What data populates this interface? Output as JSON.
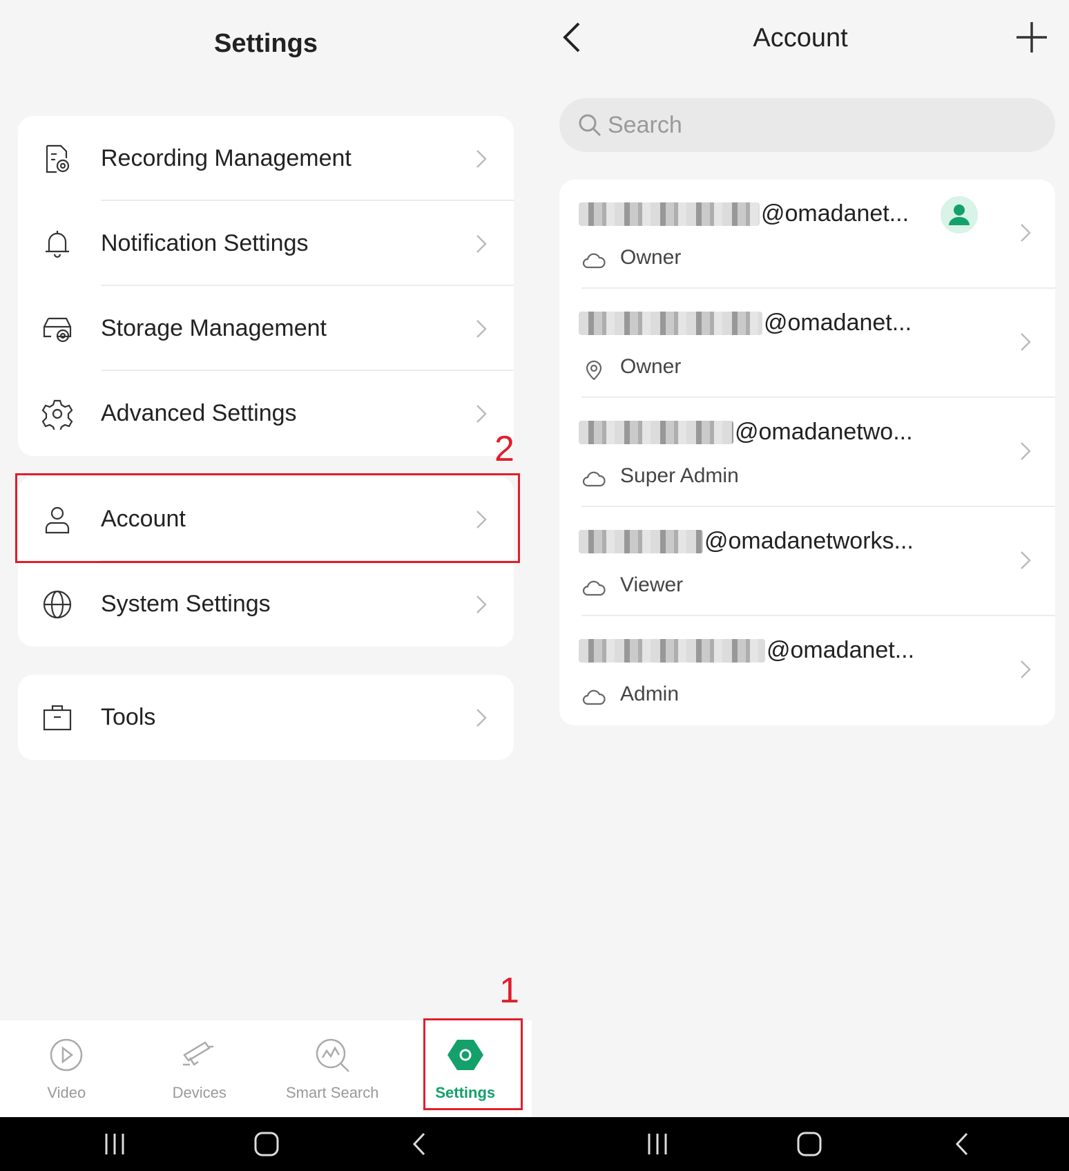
{
  "left": {
    "title": "Settings",
    "group1": [
      {
        "label": "Recording Management",
        "icon": "recording-management-icon"
      },
      {
        "label": "Notification Settings",
        "icon": "bell-icon"
      },
      {
        "label": "Storage Management",
        "icon": "storage-icon"
      },
      {
        "label": "Advanced Settings",
        "icon": "gear-icon"
      }
    ],
    "group2": [
      {
        "label": "Account",
        "icon": "user-icon"
      },
      {
        "label": "System Settings",
        "icon": "globe-icon"
      }
    ],
    "group3": [
      {
        "label": "Tools",
        "icon": "toolbox-icon"
      }
    ],
    "annotations": {
      "step1": "1",
      "step2": "2"
    },
    "bottom_nav": [
      {
        "label": "Video",
        "icon": "video-play-icon",
        "active": false
      },
      {
        "label": "Devices",
        "icon": "camera-icon",
        "active": false
      },
      {
        "label": "Smart Search",
        "icon": "smart-search-icon",
        "active": false
      },
      {
        "label": "Settings",
        "icon": "settings-hex-icon",
        "active": true
      }
    ]
  },
  "right": {
    "title": "Account",
    "search_placeholder": "Search",
    "accounts": [
      {
        "email": "@omadanet...",
        "role": "Owner",
        "role_icon": "cloud-icon",
        "is_current_user": true
      },
      {
        "email": "@omadanet...",
        "role": "Owner",
        "role_icon": "location-pin-icon",
        "is_current_user": false
      },
      {
        "email": "@omadanetwo...",
        "role": "Super Admin",
        "role_icon": "cloud-icon",
        "is_current_user": false
      },
      {
        "email": "@omadanetworks...",
        "role": "Viewer",
        "role_icon": "cloud-icon",
        "is_current_user": false
      },
      {
        "email": "@omadanet...",
        "role": "Admin",
        "role_icon": "cloud-icon",
        "is_current_user": false
      }
    ]
  },
  "colors": {
    "accent": "#14a06a",
    "annotation": "#e01e2b",
    "background": "#f5f5f5"
  }
}
